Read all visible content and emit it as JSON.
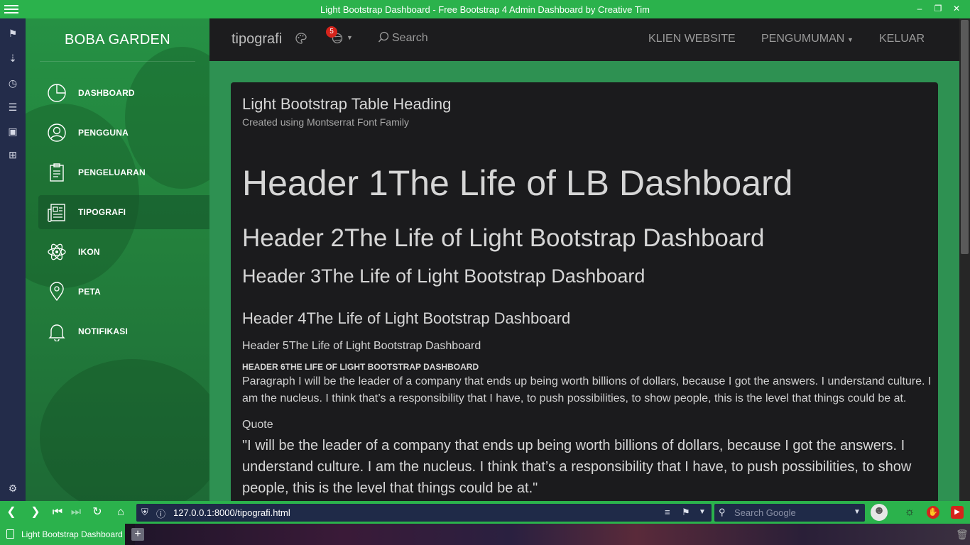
{
  "browser": {
    "window_title": "Light Bootstrap Dashboard - Free Bootstrap 4 Admin Dashboard by Creative Tim",
    "url": "127.0.0.1:8000/tipografi.html",
    "search_placeholder": "Search Google",
    "tab_label": "Light Bootstrap Dashboard"
  },
  "sidebar": {
    "brand": "BOBA GARDEN",
    "accent_color": "#2bb24c",
    "items": [
      {
        "label": "DASHBOARD",
        "icon": "pie-chart-icon"
      },
      {
        "label": "PENGGUNA",
        "icon": "user-circle-icon"
      },
      {
        "label": "PENGELUARAN",
        "icon": "clipboard-icon"
      },
      {
        "label": "TIPOGRAFI",
        "icon": "newspaper-icon",
        "active": true
      },
      {
        "label": "IKON",
        "icon": "atom-icon"
      },
      {
        "label": "PETA",
        "icon": "map-pin-icon"
      },
      {
        "label": "NOTIFIKASI",
        "icon": "bell-icon"
      }
    ]
  },
  "navbar": {
    "brand": "tipografi",
    "notification_count": "5",
    "search_label": "Search",
    "links": {
      "klien": "KLIEN WEBSITE",
      "pengumuman": "PENGUMUMAN",
      "keluar": "KELUAR"
    }
  },
  "card": {
    "title": "Light Bootstrap Table Heading",
    "subtitle": "Created using Montserrat Font Family",
    "h1": "Header 1The Life of LB Dashboard",
    "h2": "Header 2The Life of Light Bootstrap Dashboard",
    "h3": "Header 3The Life of Light Bootstrap Dashboard",
    "h4": "Header 4The Life of Light Bootstrap Dashboard",
    "h5": "Header 5The Life of Light Bootstrap Dashboard",
    "h6": "HEADER 6THE LIFE OF LIGHT BOOTSTRAP DASHBOARD",
    "paragraph": "Paragraph I will be the leader of a company that ends up being worth billions of dollars, because I got the answers. I understand culture. I am the nucleus. I think that’s a responsibility that I have, to push possibilities, to show people, this is the level that things could be at.",
    "quote_label": "Quote",
    "quote": "\"I will be the leader of a company that ends up being worth billions of dollars, because I got the answers. I understand culture. I am the nucleus. I think that’s a responsibility that I have, to push possibilities, to show people, this is the level that things could be at.\""
  }
}
